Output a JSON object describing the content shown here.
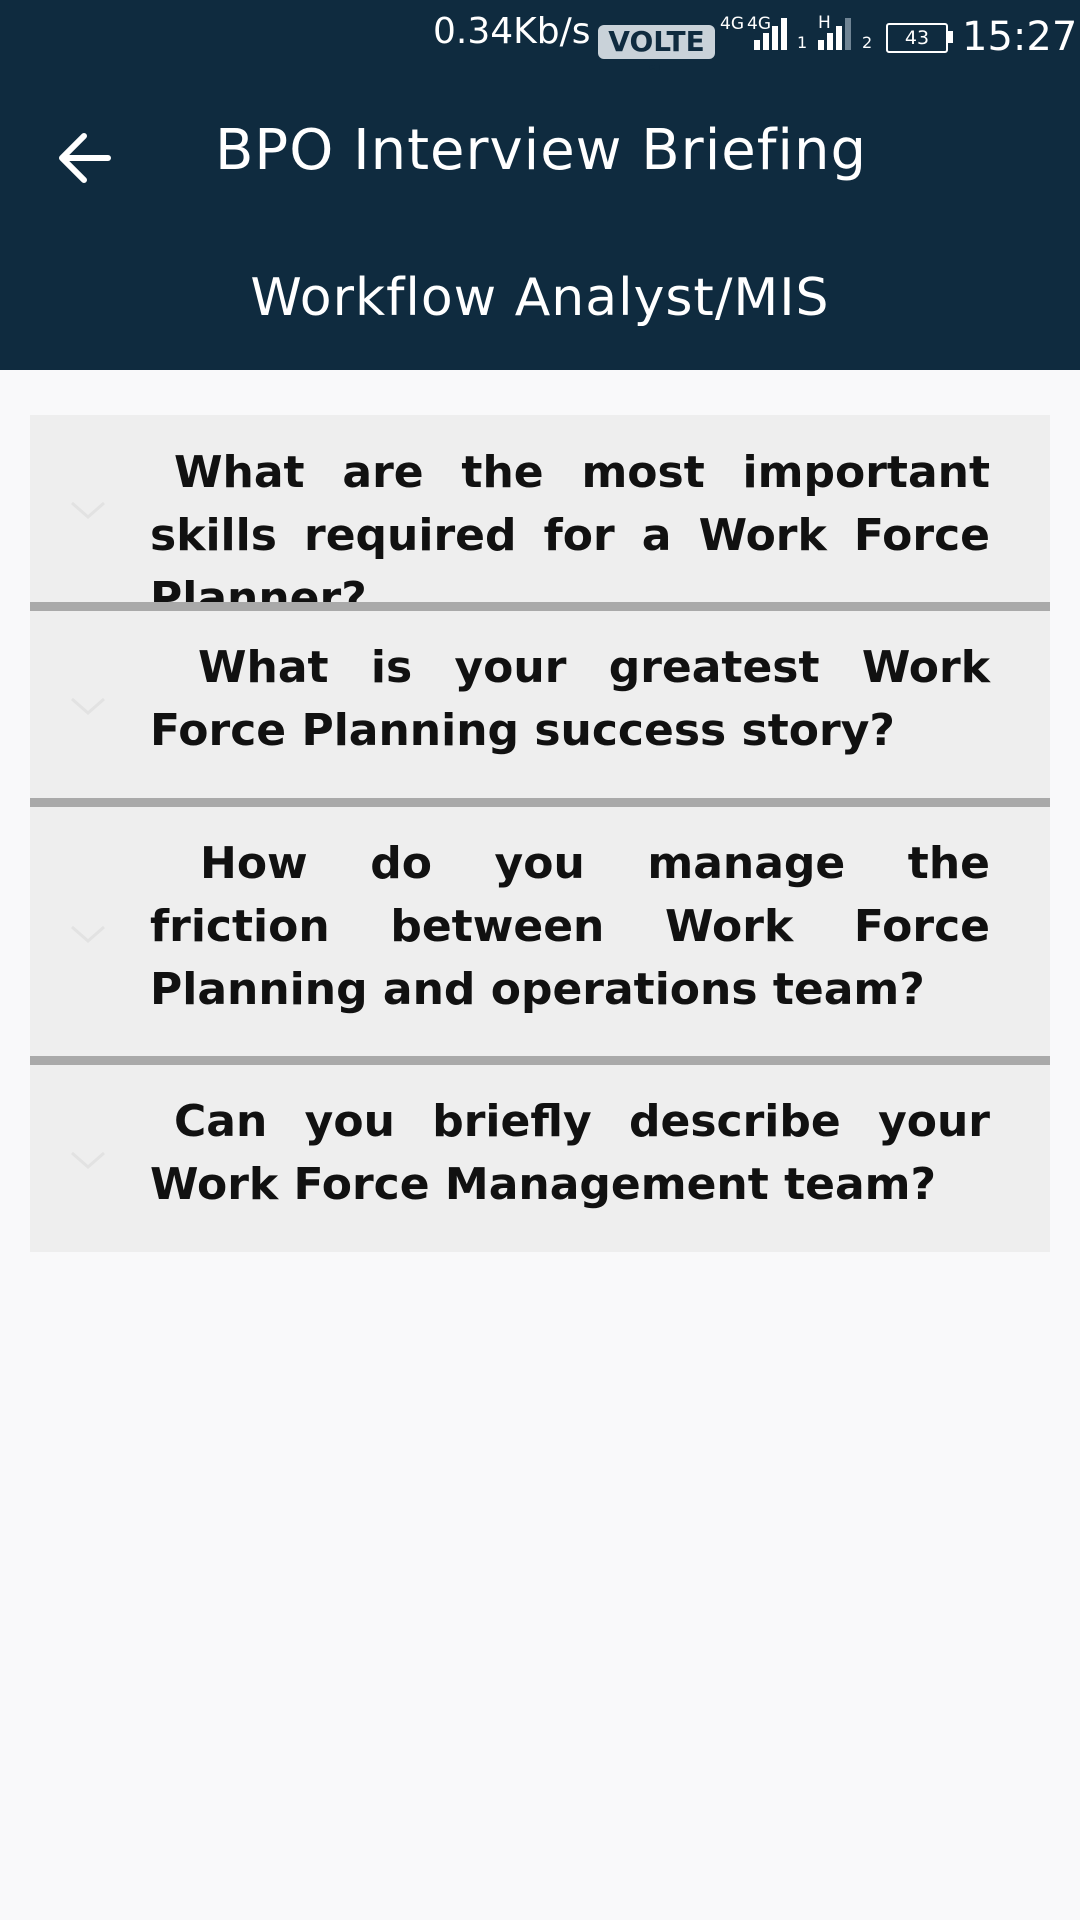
{
  "status_bar": {
    "speed": "0.34Kb/s",
    "volte": "VOLTE 1",
    "net_1": "4G",
    "net_2": "4G",
    "sim_1": "1",
    "net_3": "H",
    "sim_2": "2",
    "battery": "43",
    "time": "15:27"
  },
  "header": {
    "back_icon": "arrow-left-icon",
    "title": "BPO Interview Briefing",
    "subtitle": "Workflow Analyst/MIS"
  },
  "questions": [
    {
      "text": "What are the most important skills required for a Work Force Planner?",
      "icon": "chevron-down-icon"
    },
    {
      "text": "What is your greatest Work Force Planning success story?",
      "icon": "chevron-down-icon"
    },
    {
      "text": "How do you manage the friction between Work Force Planning and operations team?",
      "icon": "chevron-down-icon"
    },
    {
      "text": "Can you briefly describe your Work Force Management team?",
      "icon": "chevron-down-icon"
    }
  ],
  "colors": {
    "header_bg": "#0f2b3f",
    "page_bg": "#f9f9fa",
    "item_bg": "#eeeeee",
    "divider": "#a9a9a9"
  }
}
